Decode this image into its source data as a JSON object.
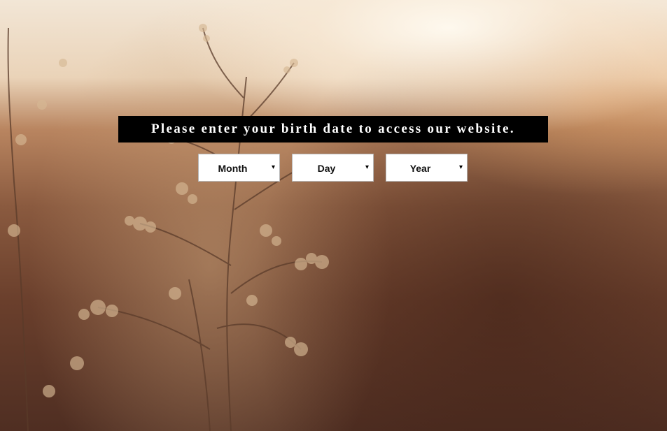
{
  "age_gate": {
    "prompt": "Please enter your birth date to access our website.",
    "month": {
      "value": "Month",
      "caret_icon": "▾"
    },
    "day": {
      "value": "Day",
      "caret_icon": "▾"
    },
    "year": {
      "value": "Year",
      "caret_icon": "▾"
    }
  },
  "background": {
    "description_icon": "plant-photo",
    "colors": {
      "sky": "#f2e6d6",
      "field": "#6a3f2c",
      "plant": "#c9a27e"
    }
  }
}
